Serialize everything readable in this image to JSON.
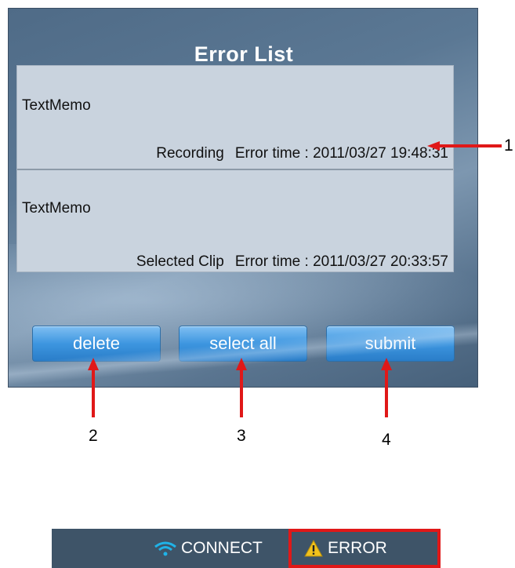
{
  "error_list": {
    "title": "Error List",
    "items": [
      {
        "memo": "TextMemo",
        "source": "Recording",
        "error_time": "Error time : 2011/03/27 19:48:31"
      },
      {
        "memo": "TextMemo",
        "source": "Selected Clip",
        "error_time": "Error time : 2011/03/27 20:33:57"
      }
    ]
  },
  "buttons": {
    "delete": "delete",
    "select_all": "select all",
    "submit": "submit"
  },
  "callouts": {
    "n1": "1",
    "n2": "2",
    "n3": "3",
    "n4": "4"
  },
  "status_bar": {
    "connect_label": "CONNECT",
    "connect_icon": "wifi-icon",
    "error_label": "ERROR",
    "error_icon": "warning-icon"
  },
  "colors": {
    "callout": "#e01818",
    "button": "#3d96e0",
    "panel": "#5b7894",
    "connect_icon": "#1fb3e8",
    "warning_icon": "#f2c21b"
  }
}
